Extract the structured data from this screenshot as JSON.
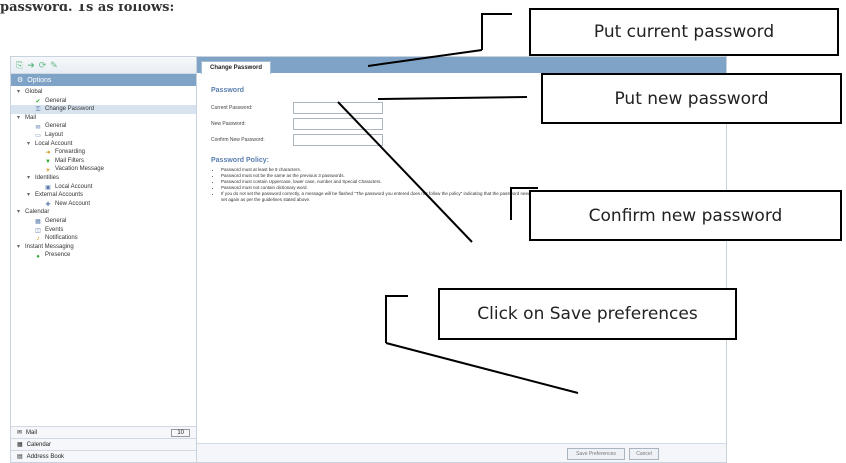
{
  "header_text": "password. 1s as follows:",
  "app": {
    "toolbar_icons": [
      "new-icon",
      "forward-icon",
      "refresh-icon",
      "pin-icon"
    ],
    "options_title": "Options",
    "tree": [
      {
        "label": "Global",
        "level": 0,
        "icon": "",
        "twisty": "▾"
      },
      {
        "label": "General",
        "level": 1,
        "icon": "check-icon"
      },
      {
        "label": "Change Password",
        "level": 1,
        "icon": "key-icon",
        "selected": true
      },
      {
        "label": "Mail",
        "level": 0,
        "icon": "",
        "twisty": "▾"
      },
      {
        "label": "General",
        "level": 1,
        "icon": "mail-icon"
      },
      {
        "label": "Layout",
        "level": 1,
        "icon": "layout-icon"
      },
      {
        "label": "Local Account",
        "level": 1,
        "icon": "",
        "twisty": "▾"
      },
      {
        "label": "Forwarding",
        "level": 2,
        "icon": "forward-icon"
      },
      {
        "label": "Mail Filters",
        "level": 2,
        "icon": "filter-icon"
      },
      {
        "label": "Vacation Message",
        "level": 2,
        "icon": "vacation-icon"
      },
      {
        "label": "Identities",
        "level": 1,
        "icon": "",
        "twisty": "▾"
      },
      {
        "label": "Local Account",
        "level": 2,
        "icon": "account-icon"
      },
      {
        "label": "External Accounts",
        "level": 1,
        "icon": "",
        "twisty": "▾"
      },
      {
        "label": "New Account",
        "level": 2,
        "icon": "new-account-icon"
      },
      {
        "label": "Calendar",
        "level": 0,
        "icon": "",
        "twisty": "▾"
      },
      {
        "label": "General",
        "level": 1,
        "icon": "calendar-icon"
      },
      {
        "label": "Events",
        "level": 1,
        "icon": "events-icon"
      },
      {
        "label": "Notifications",
        "level": 1,
        "icon": "bell-icon"
      },
      {
        "label": "Instant Messaging",
        "level": 0,
        "icon": "",
        "twisty": "▾"
      },
      {
        "label": "Presence",
        "level": 1,
        "icon": "presence-icon"
      }
    ],
    "bottom_nav": [
      {
        "label": "Mail",
        "icon": "mail-icon",
        "badge": "10"
      },
      {
        "label": "Calendar",
        "icon": "calendar-icon"
      },
      {
        "label": "Address Book",
        "icon": "address-book-icon"
      }
    ],
    "tab_label": "Change Password",
    "section_password": "Password",
    "fields": {
      "current": "Current Password:",
      "new": "New Password:",
      "confirm": "Confirm New Password:"
    },
    "section_policy": "Password Policy:",
    "policy": [
      "Password must at least be 8 characters.",
      "Password must not be the same as the previous 3 passwords.",
      "Password must contain Uppercase, lower case, number and Special Characters.",
      "Password must not contain dictionary word.",
      "If you do not set the password correctly, a message will be flashed \"The password you entered does not follow the policy\" indicating that the password needs to be set again as per the guidelines stated above."
    ],
    "save_label": "Save Preferences",
    "cancel_label": "Cancel"
  },
  "callouts": {
    "current": "Put current password",
    "new": "Put new password",
    "confirm": "Confirm new password",
    "save": "Click on Save preferences"
  }
}
